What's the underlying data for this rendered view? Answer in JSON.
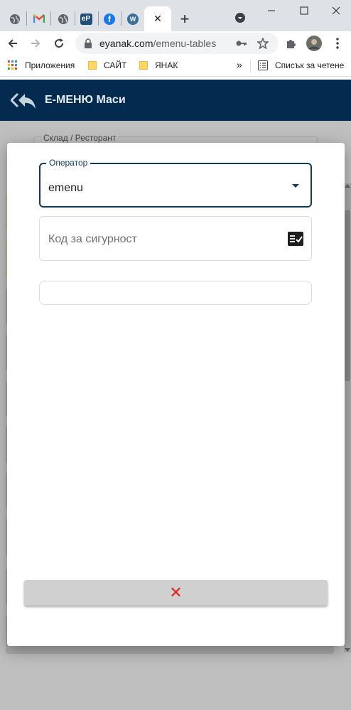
{
  "browser": {
    "tabs": [
      {
        "icon": "globe-icon",
        "title": ""
      },
      {
        "icon": "gmail-icon",
        "title": "M"
      },
      {
        "icon": "globe-icon",
        "title": ""
      },
      {
        "icon": "ep-icon",
        "title": "eP"
      },
      {
        "icon": "facebook-icon",
        "title": "f"
      },
      {
        "icon": "wordpress-icon",
        "title": "W"
      }
    ],
    "active_tab_close": "✕",
    "new_tab": "+",
    "address": {
      "host": "eyanak.com",
      "path": "/emenu-tables"
    },
    "bookmarks": {
      "apps": "Приложения",
      "items": [
        "САЙТ",
        "ЯНАК"
      ],
      "overflow": "»",
      "reading_list": "Списък за четене"
    }
  },
  "app": {
    "title": "Е-МЕНЮ Маси",
    "background": {
      "store_legend": "Склад / Ресторант"
    }
  },
  "modal": {
    "operator_label": "Оператор",
    "operator_value": "emenu",
    "security_code_placeholder": "Код за сигурност",
    "close_label": "✕"
  },
  "colors": {
    "header_bg": "#022b4f",
    "accent": "#0d3b5c",
    "close_icon": "#e02020",
    "scrim": "#bfbfbf"
  }
}
